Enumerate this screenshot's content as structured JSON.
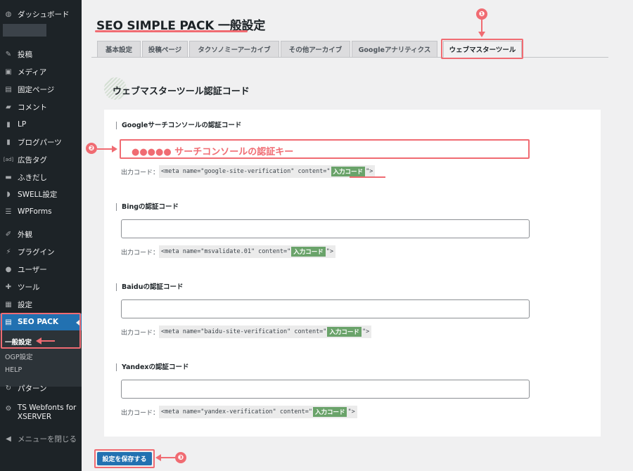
{
  "sidebar": {
    "items": [
      {
        "label": "ダッシュボード",
        "icon": "dashboard-icon"
      },
      {
        "label": "投稿",
        "icon": "pin-icon"
      },
      {
        "label": "メディア",
        "icon": "media-icon"
      },
      {
        "label": "固定ページ",
        "icon": "page-icon"
      },
      {
        "label": "コメント",
        "icon": "comment-icon"
      },
      {
        "label": "LP",
        "icon": "folder-icon"
      },
      {
        "label": "ブログパーツ",
        "icon": "folder-icon"
      },
      {
        "label": "広告タグ",
        "icon": "ad-icon"
      },
      {
        "label": "ふきだし",
        "icon": "speech-icon"
      },
      {
        "label": "SWELL設定",
        "icon": "swell-icon"
      },
      {
        "label": "WPForms",
        "icon": "forms-icon"
      },
      {
        "label": "外観",
        "icon": "brush-icon"
      },
      {
        "label": "プラグイン",
        "icon": "plugin-icon"
      },
      {
        "label": "ユーザー",
        "icon": "user-icon"
      },
      {
        "label": "ツール",
        "icon": "wrench-icon"
      },
      {
        "label": "設定",
        "icon": "settings-icon"
      },
      {
        "label": "SEO PACK",
        "icon": "list-icon"
      },
      {
        "label": "パターン",
        "icon": "pattern-icon"
      },
      {
        "label": "TS Webfonts for XSERVER",
        "icon": "gear-icon"
      },
      {
        "label": "メニューを閉じる",
        "icon": "collapse-icon"
      }
    ],
    "submenu": [
      "一般設定",
      "OGP設定",
      "HELP"
    ]
  },
  "page": {
    "title": "SEO SIMPLE PACK 一般設定",
    "tabs": [
      "基本設定",
      "投稿ページ",
      "タクソノミーアーカイブ",
      "その他アーカイブ",
      "Googleアナリティクス",
      "ウェブマスターツール"
    ],
    "section_title": "ウェブマスターツール認証コード"
  },
  "fields": [
    {
      "label": "Googleサーチコンソールの認証コード",
      "value": "●●●●● サーチコンソールの認証キー",
      "code_prefix": "出力コード：",
      "code_before": "<meta name=\"google-site-verification\" content=\"",
      "code_tag": "入力コード",
      "code_after": "\">"
    },
    {
      "label": "Bingの認証コード",
      "value": "",
      "code_prefix": "出力コード：",
      "code_before": "<meta name=\"msvalidate.01\" content=\"",
      "code_tag": "入力コード",
      "code_after": "\">"
    },
    {
      "label": "Baiduの認証コード",
      "value": "",
      "code_prefix": "出力コード：",
      "code_before": "<meta name=\"baidu-site-verification\" content=\"",
      "code_tag": "入力コード",
      "code_after": "\">"
    },
    {
      "label": "Yandexの認証コード",
      "value": "",
      "code_prefix": "出力コード：",
      "code_before": "<meta name=\"yandex-verification\" content=\"",
      "code_tag": "入力コード",
      "code_after": "\">"
    }
  ],
  "save_label": "設定を保存する",
  "markers": [
    "❶",
    "❷",
    "❸"
  ],
  "colors": {
    "accent": "#f06b72",
    "wp_blue": "#2271b1",
    "sidebar": "#1d2327",
    "tag_green": "#6aa36a"
  }
}
